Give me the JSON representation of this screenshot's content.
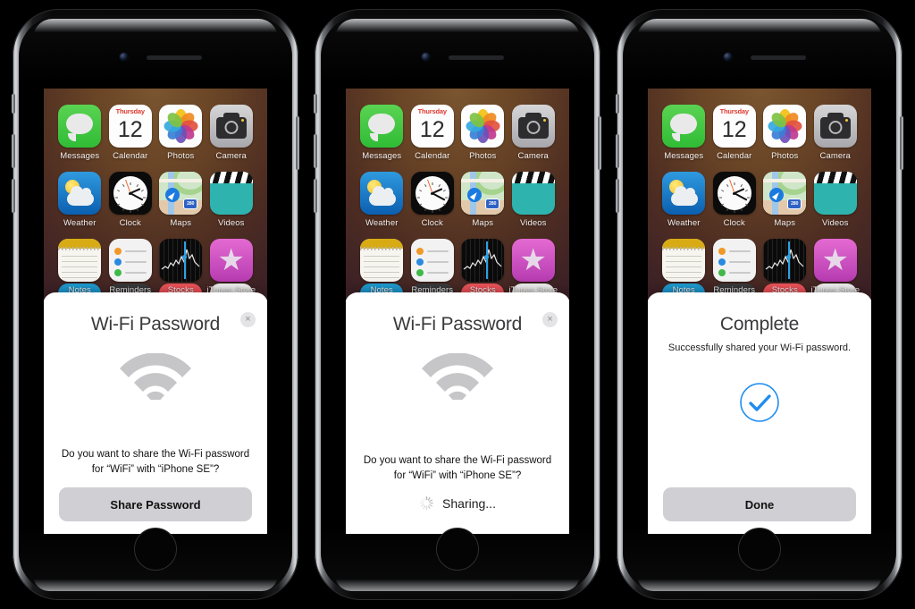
{
  "homescreen": {
    "apps_row1": [
      {
        "label": "Messages",
        "icon": "messages-icon"
      },
      {
        "label": "Calendar",
        "icon": "calendar-icon",
        "weekday": "Thursday",
        "day": "12"
      },
      {
        "label": "Photos",
        "icon": "photos-icon"
      },
      {
        "label": "Camera",
        "icon": "camera-icon"
      }
    ],
    "apps_row2": [
      {
        "label": "Weather",
        "icon": "weather-icon"
      },
      {
        "label": "Clock",
        "icon": "clock-icon"
      },
      {
        "label": "Maps",
        "icon": "maps-icon",
        "shield": "280"
      },
      {
        "label": "Videos",
        "icon": "videos-icon"
      }
    ],
    "apps_row3": [
      {
        "label": "Notes",
        "icon": "notes-icon"
      },
      {
        "label": "Reminders",
        "icon": "reminders-icon"
      },
      {
        "label": "Stocks",
        "icon": "stocks-icon"
      },
      {
        "label": "iTunes Store",
        "icon": "itunes-store-icon"
      }
    ]
  },
  "phones": [
    {
      "state": "prompt",
      "sheet": {
        "title": "Wi-Fi Password",
        "close_label": "×",
        "glyph": "wifi-icon",
        "body": "Do you want to share the Wi-Fi password for “WiFi” with “iPhone SE”?",
        "button_label": "Share Password"
      }
    },
    {
      "state": "sharing",
      "sheet": {
        "title": "Wi-Fi Password",
        "close_label": "×",
        "glyph": "wifi-icon",
        "body": "Do you want to share the Wi-Fi password for “WiFi” with “iPhone SE”?",
        "status_label": "Sharing...",
        "spinner": "activity-indicator-icon"
      }
    },
    {
      "state": "complete",
      "sheet": {
        "title": "Complete",
        "subtitle": "Successfully shared your Wi-Fi password.",
        "glyph": "checkmark-circle-icon",
        "button_label": "Done"
      }
    }
  ],
  "colors": {
    "accent_blue": "#1f8cf0",
    "button_gray": "#d0d0d4",
    "sheet_white": "#ffffff",
    "wifi_gray": "#c6c6c8"
  }
}
